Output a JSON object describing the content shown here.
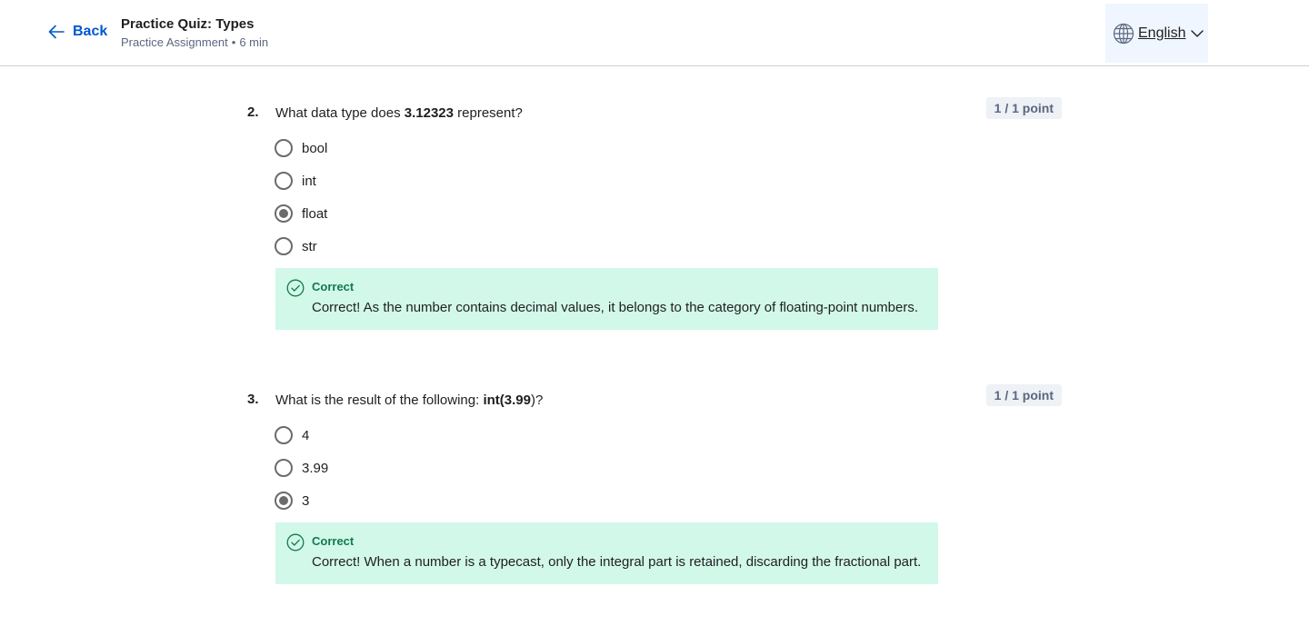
{
  "header": {
    "back_label": "Back",
    "title": "Practice Quiz: Types",
    "subtitle_type": "Practice Assignment",
    "subtitle_separator": "•",
    "subtitle_duration": "6 min",
    "language": "English"
  },
  "questions": [
    {
      "number": "2.",
      "text_before": "What data type does ",
      "text_bold": "3.12323",
      "text_after": " represent?",
      "points": "1 / 1 point",
      "options": [
        {
          "label": "bool",
          "selected": false
        },
        {
          "label": "int",
          "selected": false
        },
        {
          "label": "float",
          "selected": true
        },
        {
          "label": "str",
          "selected": false
        }
      ],
      "feedback": {
        "title": "Correct",
        "text": "Correct! As the number contains decimal values, it belongs to the category of floating-point numbers."
      }
    },
    {
      "number": "3.",
      "text_before": "What is the result of the following: ",
      "text_bold": "int(3.99",
      "text_after": ")?",
      "points": "1 / 1 point",
      "options": [
        {
          "label": "4",
          "selected": false
        },
        {
          "label": "3.99",
          "selected": false
        },
        {
          "label": "3",
          "selected": true
        }
      ],
      "feedback": {
        "title": "Correct",
        "text": "Correct! When a number is a typecast, only the integral part is retained, discarding the fractional part."
      }
    }
  ],
  "colors": {
    "accent": "#0056d2",
    "correct_bg": "#d2f8ea",
    "correct_text": "#117a4e"
  }
}
